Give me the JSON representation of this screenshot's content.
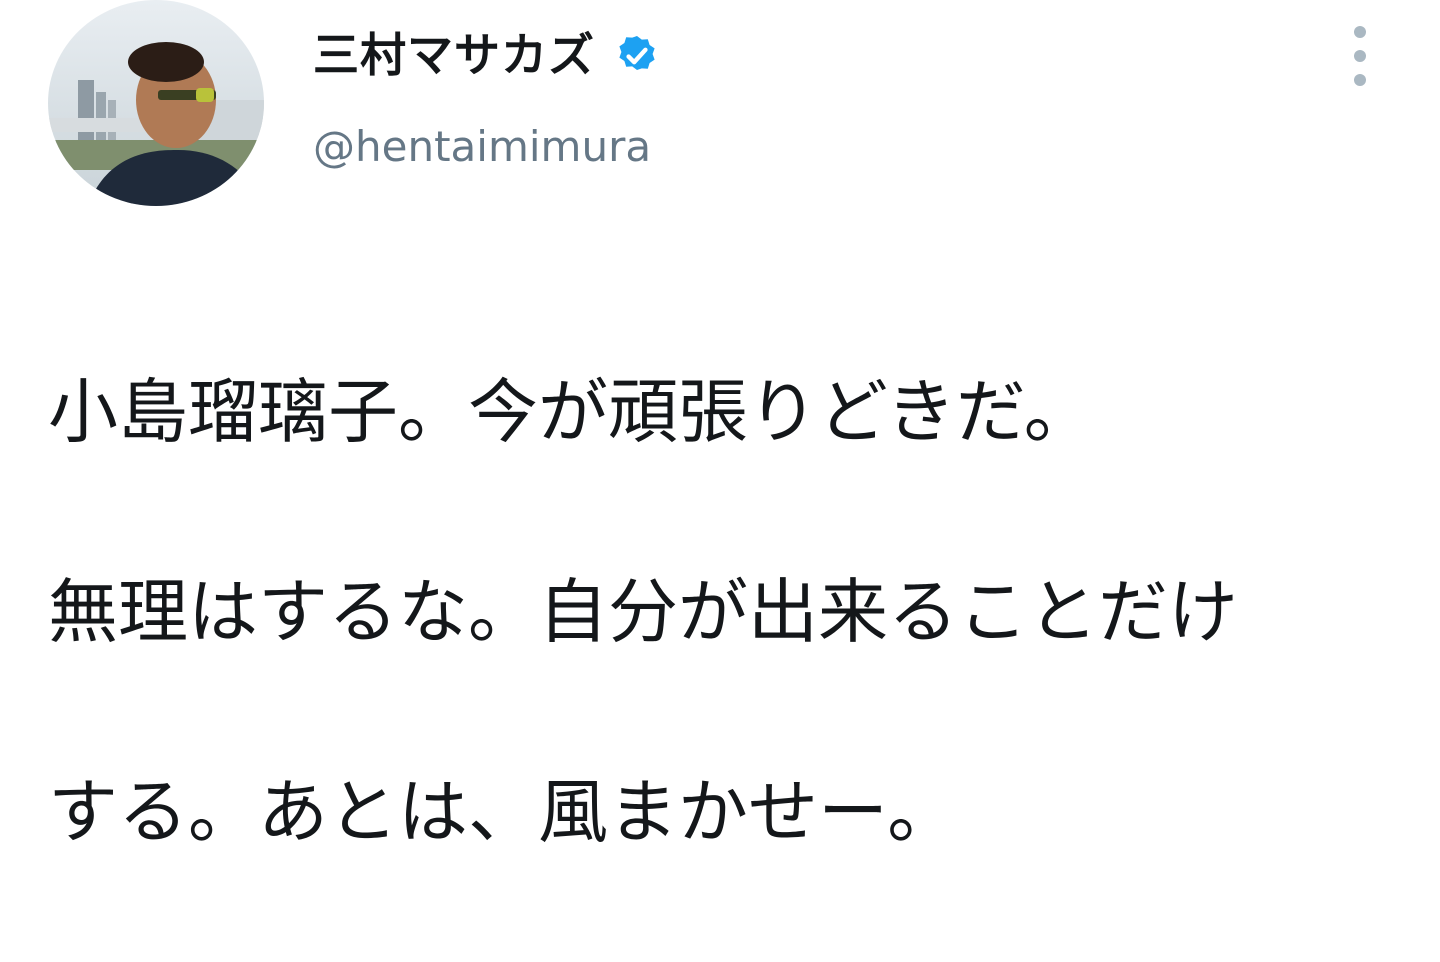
{
  "user": {
    "display_name": "三村マサカズ",
    "handle": "@hentaimimura",
    "verified_icon": "verified-badge-icon",
    "avatar": "profile-photo"
  },
  "menu": {
    "icon": "more-vertical-icon"
  },
  "tweet": {
    "lines": [
      "小島瑠璃子。今が頑張りどきだ。",
      "無理はするな。自分が出来ることだけ",
      "する。あとは、風まかせー。"
    ]
  },
  "colors": {
    "text": "#14171a",
    "secondary": "#657786",
    "verified": "#1da1f2",
    "menu_dots": "#aab8c2"
  }
}
